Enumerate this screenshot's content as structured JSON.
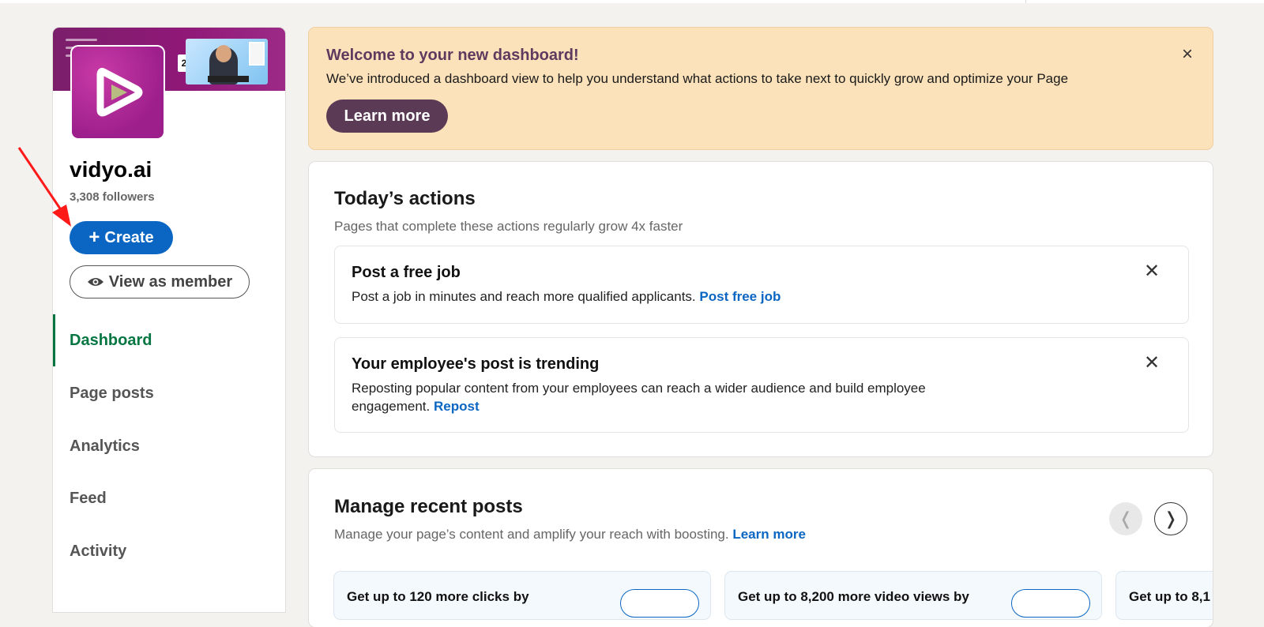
{
  "company": {
    "name": "vidyo.ai",
    "followers": "3,308 followers",
    "cover_badge": "2X"
  },
  "sidebar": {
    "create_label": "Create",
    "view_member_label": "View as member",
    "items": [
      {
        "label": "Dashboard",
        "active": true
      },
      {
        "label": "Page posts",
        "active": false
      },
      {
        "label": "Analytics",
        "active": false
      },
      {
        "label": "Feed",
        "active": false
      },
      {
        "label": "Activity",
        "active": false
      }
    ]
  },
  "banner": {
    "title": "Welcome to your new dashboard!",
    "description": "We’ve introduced a dashboard view to help you understand what actions to take next to quickly grow and optimize your Page",
    "button_label": "Learn more",
    "close_icon": "×"
  },
  "todays_actions": {
    "title": "Today’s actions",
    "subtitle": "Pages that complete these actions regularly grow 4x faster",
    "actions": [
      {
        "title": "Post a free job",
        "description": "Post a job in minutes and reach more qualified applicants.",
        "link": "Post free job"
      },
      {
        "title": "Your employee's post is trending",
        "description": "Reposting popular content from your employees can reach a wider audience and build employee engagement.",
        "link": "Repost"
      }
    ]
  },
  "recent_posts": {
    "title": "Manage recent posts",
    "subtitle": "Manage your page’s content and amplify your reach with boosting.",
    "link": "Learn more",
    "prev_icon": "❬",
    "next_icon": "❭",
    "cards": [
      {
        "title": "Get up to 120 more clicks by"
      },
      {
        "title": "Get up to 8,200 more video views by"
      },
      {
        "title": "Get up to 8,1"
      }
    ]
  },
  "colors": {
    "accent": "#0a66c2",
    "active_nav": "#057642",
    "banner_bg": "#fce2ba",
    "banner_button": "#5b3a55",
    "annotation_arrow": "#ff1a1a"
  }
}
